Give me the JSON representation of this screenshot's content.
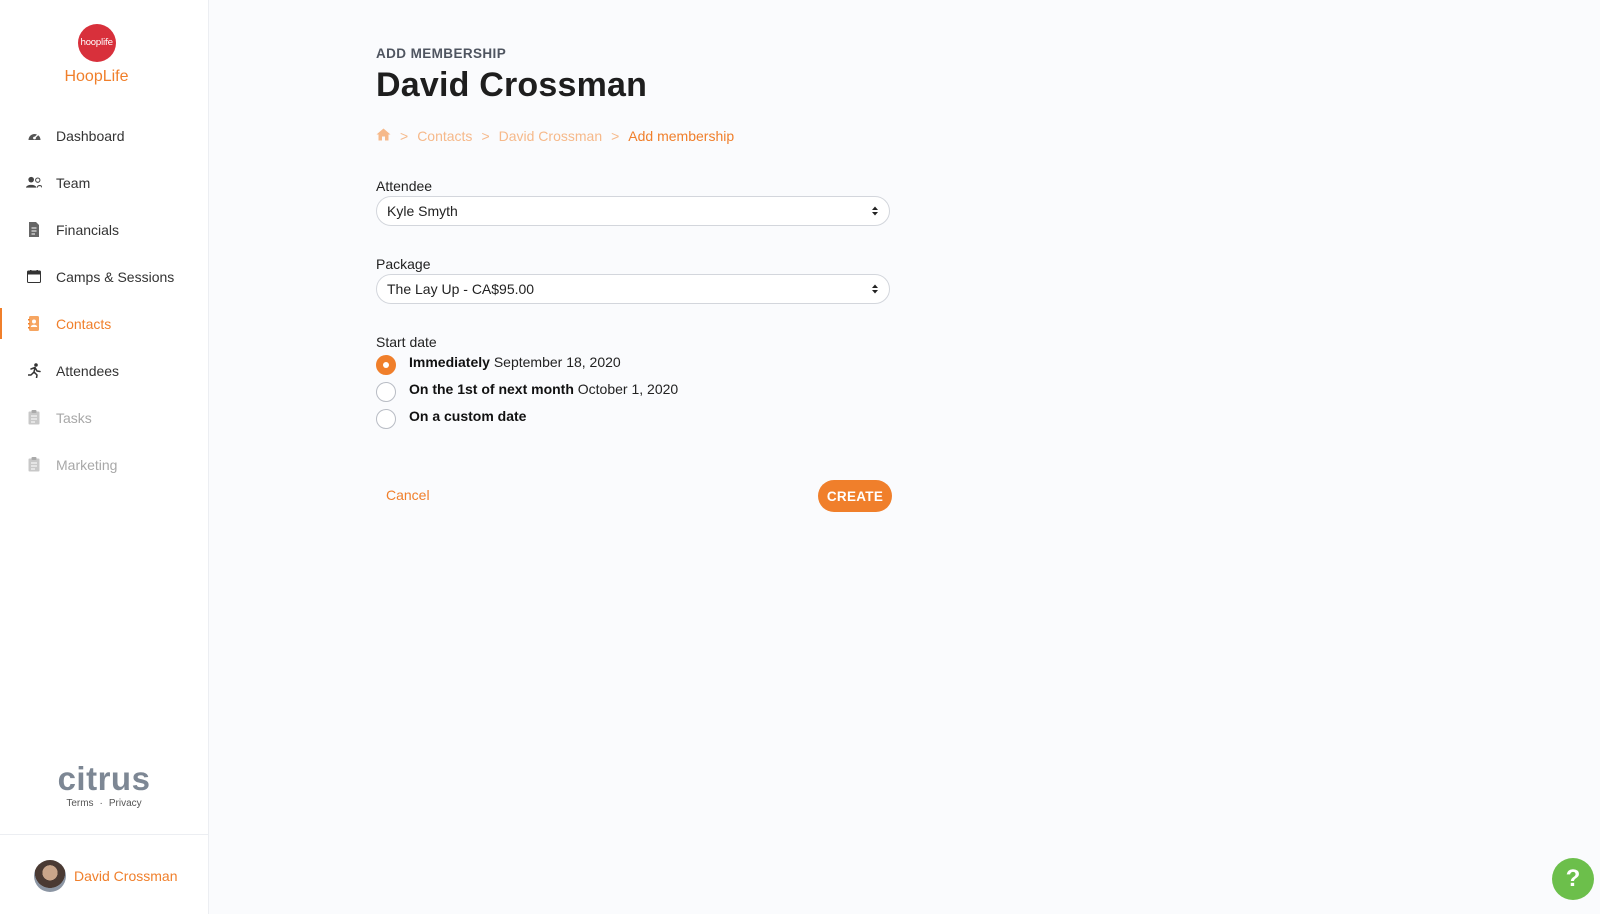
{
  "brand": {
    "logo_text": "hooplife",
    "name": "HoopLife"
  },
  "sidebar": {
    "items": [
      {
        "label": "Dashboard",
        "icon": "speedometer-icon",
        "state": "normal"
      },
      {
        "label": "Team",
        "icon": "users-icon",
        "state": "normal"
      },
      {
        "label": "Financials",
        "icon": "receipt-icon",
        "state": "normal"
      },
      {
        "label": "Camps & Sessions",
        "icon": "calendar-icon",
        "state": "normal"
      },
      {
        "label": "Contacts",
        "icon": "address-book-icon",
        "state": "active"
      },
      {
        "label": "Attendees",
        "icon": "running-person-icon",
        "state": "normal"
      },
      {
        "label": "Tasks",
        "icon": "clipboard-icon",
        "state": "disabled"
      },
      {
        "label": "Marketing",
        "icon": "clipboard-icon",
        "state": "disabled"
      }
    ]
  },
  "footer": {
    "logo": "citrus",
    "terms": "Terms",
    "dot": "·",
    "privacy": "Privacy"
  },
  "user": {
    "name": "David Crossman"
  },
  "page": {
    "eyebrow": "ADD MEMBERSHIP",
    "title": "David Crossman",
    "breadcrumb": {
      "sep": ">",
      "items": [
        "Contacts",
        "David Crossman",
        "Add membership"
      ]
    }
  },
  "form": {
    "attendee": {
      "label": "Attendee",
      "value": "Kyle Smyth"
    },
    "package": {
      "label": "Package",
      "value": "The Lay Up - CA$95.00"
    },
    "start_date": {
      "label": "Start date",
      "options": [
        {
          "bold": "Immediately",
          "detail": "September 18, 2020",
          "checked": true
        },
        {
          "bold": "On the 1st of next month",
          "detail": "October 1, 2020",
          "checked": false
        },
        {
          "bold": "On a custom date",
          "detail": "",
          "checked": false
        }
      ]
    },
    "cancel_label": "Cancel",
    "create_label": "CREATE"
  },
  "help": {
    "label": "?"
  },
  "colors": {
    "accent": "#f07f2b",
    "brand_red": "#d8303b",
    "help_green": "#6cbf4b"
  }
}
